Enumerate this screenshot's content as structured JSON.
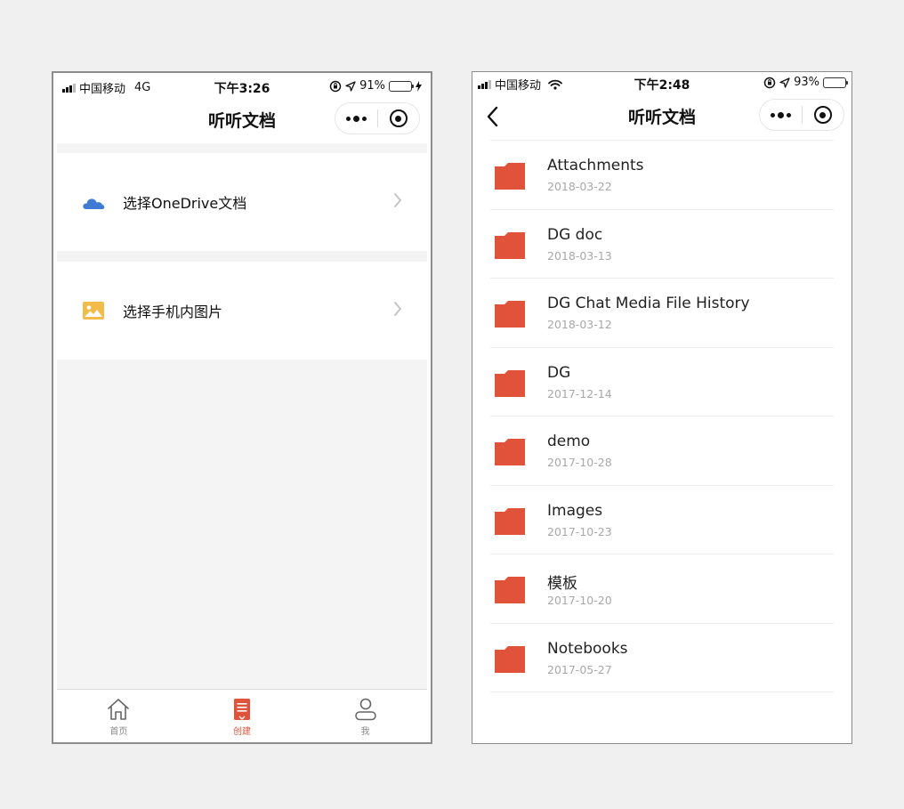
{
  "phone_left": {
    "status": {
      "carrier": "中国移动",
      "network": "4G",
      "time": "下午3:26",
      "battery_pct": "91%",
      "battery_level": 0.91,
      "battery_color": "#4cd964"
    },
    "title": "听听文档",
    "options": [
      {
        "label": "选择OneDrive文档",
        "icon": "onedrive-cloud-icon",
        "color": "#3f7bd4"
      },
      {
        "label": "选择手机内图片",
        "icon": "image-icon",
        "color": "#f2bb4a"
      }
    ],
    "tabs": [
      {
        "label": "首页",
        "icon": "home-icon",
        "active": false
      },
      {
        "label": "创建",
        "icon": "create-document-icon",
        "active": true
      },
      {
        "label": "我",
        "icon": "user-icon",
        "active": false
      }
    ],
    "accent": "#e0533a"
  },
  "phone_right": {
    "status": {
      "carrier": "中国移动",
      "network": "wifi",
      "time": "下午2:48",
      "battery_pct": "93%",
      "battery_level": 0.93,
      "battery_color": "#111111"
    },
    "title": "听听文档",
    "folders": [
      {
        "name": "Attachments",
        "date": "2018-03-22"
      },
      {
        "name": "DG doc",
        "date": "2018-03-13"
      },
      {
        "name": "DG Chat Media File History",
        "date": "2018-03-12"
      },
      {
        "name": "DG",
        "date": "2017-12-14"
      },
      {
        "name": "demo",
        "date": "2017-10-28"
      },
      {
        "name": "Images",
        "date": "2017-10-23"
      },
      {
        "name": "模板",
        "date": "2017-10-20"
      },
      {
        "name": "Notebooks",
        "date": "2017-05-27"
      }
    ],
    "folder_color": "#e0533a"
  }
}
